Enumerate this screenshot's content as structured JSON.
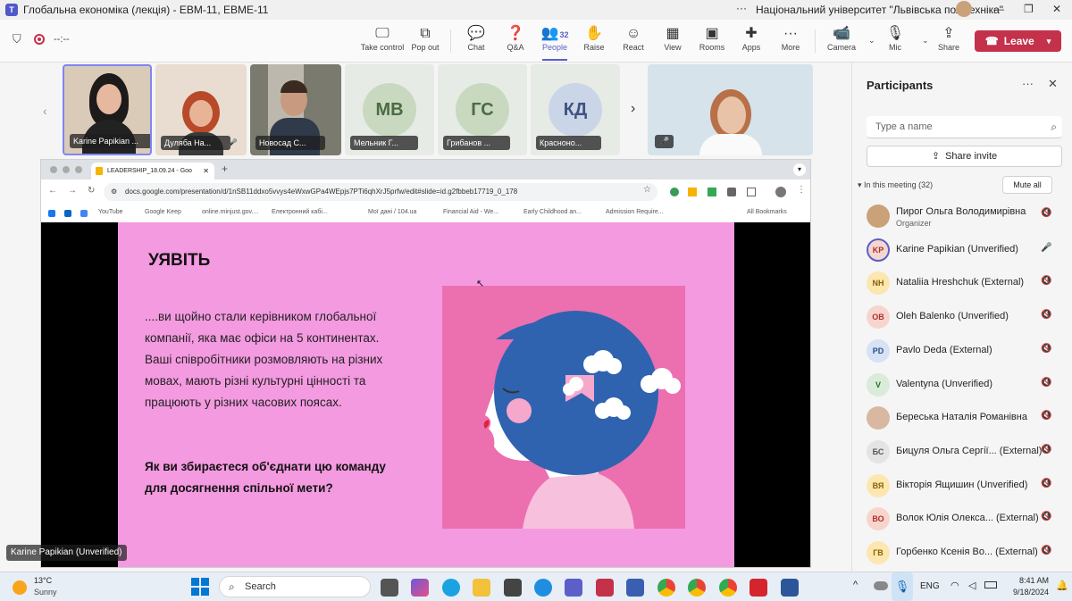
{
  "window": {
    "title": "Глобальна економіка (лекція) - ЕВМ-11, ЕВМЕ-11",
    "org": "Національний університет \"Львівська політехніка\""
  },
  "toolbar": {
    "timer": "--:--",
    "items": [
      {
        "label": "Take control",
        "icon": "take-control-icon"
      },
      {
        "label": "Pop out",
        "icon": "pop-out-icon"
      },
      {
        "label": "Chat",
        "icon": "chat-icon"
      },
      {
        "label": "Q&A",
        "icon": "qa-icon"
      },
      {
        "label": "People",
        "icon": "people-icon",
        "count": "32"
      },
      {
        "label": "Raise",
        "icon": "hand-icon"
      },
      {
        "label": "React",
        "icon": "emoji-icon"
      },
      {
        "label": "View",
        "icon": "view-icon"
      },
      {
        "label": "Rooms",
        "icon": "rooms-icon"
      },
      {
        "label": "Apps",
        "icon": "apps-icon"
      },
      {
        "label": "More",
        "icon": "more-icon"
      },
      {
        "label": "Camera",
        "icon": "camera-icon"
      },
      {
        "label": "Mic",
        "icon": "mic-off-icon"
      },
      {
        "label": "Share",
        "icon": "share-icon"
      }
    ],
    "leave": "Leave"
  },
  "gallery": [
    {
      "name": "Karine Papikian ...",
      "type": "video"
    },
    {
      "name": "Дуляба На...",
      "type": "video"
    },
    {
      "name": "Новосад С...",
      "type": "video"
    },
    {
      "name": "Мельник Г...",
      "initials": "МВ",
      "type": "avatar"
    },
    {
      "name": "Грибанов ...",
      "initials": "ГС",
      "type": "avatar"
    },
    {
      "name": "Красноно...",
      "initials": "КД",
      "type": "avatar"
    }
  ],
  "browser": {
    "tab_title": "LEADERSHIP_18.09.24 - Goo",
    "url": "docs.google.com/presentation/d/1nSB11ddxo5vvys4eWxwGPa4WEpjs7PTi6qhXrJ5prfw/edit#slide=id.g2fbbeb17719_0_178",
    "bookmarks": [
      "YouTube",
      "Google Keep",
      "online.minjust.gov....",
      "Електронний кабі...",
      "Мої дані / 104.ua",
      "Financial Aid - We...",
      "Early Childhood an...",
      "Admission Require...",
      "All Bookmarks"
    ]
  },
  "slide": {
    "title": "УЯВІТЬ",
    "body": "....ви щойно стали керівником глобальної компанії, яка має офіси на 5 континентах. Ваші співробітники розмовляють на різних мовах, мають різні культурні цінності та працюють у різних часових поясах.",
    "question": "Як ви збираєтеся об'єднати цю команду для досягнення спільної мети?"
  },
  "speaker_label": "Karine Papikian (Unverified)",
  "participants": {
    "title": "Participants",
    "search_placeholder": "Type a name",
    "share_invite": "Share invite",
    "section": "In this meeting (32)",
    "mute_all": "Mute all",
    "list": [
      {
        "name": "Пирог Ольга Володимирівна",
        "role": "Organizer",
        "initials": "",
        "bg": "#c9a27a",
        "fg": "#fff",
        "mic": "off"
      },
      {
        "name": "Karine Papikian (Unverified)",
        "role": "",
        "initials": "KP",
        "bg": "#f4d8cf",
        "fg": "#a33",
        "mic": "on"
      },
      {
        "name": "Nataliia Hreshchuk (External)",
        "role": "",
        "initials": "NH",
        "bg": "#fde7b0",
        "fg": "#8a6100",
        "mic": "off"
      },
      {
        "name": "Oleh Balenko (Unverified)",
        "role": "",
        "initials": "OB",
        "bg": "#f8d5cc",
        "fg": "#a33",
        "mic": "off"
      },
      {
        "name": "Pavlo Deda (External)",
        "role": "",
        "initials": "PD",
        "bg": "#d6e2f5",
        "fg": "#2b4f8a",
        "mic": "off"
      },
      {
        "name": "Valentyna (Unverified)",
        "role": "",
        "initials": "V",
        "bg": "#d9ecd9",
        "fg": "#2f6b2f",
        "mic": "off"
      },
      {
        "name": "Береська Наталія Романівна",
        "role": "",
        "initials": "",
        "bg": "#d8b8a0",
        "fg": "#fff",
        "mic": "off"
      },
      {
        "name": "Бицуля Ольга Сергії... (External)",
        "role": "",
        "initials": "БС",
        "bg": "#e4e4e4",
        "fg": "#555",
        "mic": "off"
      },
      {
        "name": "Вікторія Ящишин (Unverified)",
        "role": "",
        "initials": "ВЯ",
        "bg": "#fde7b0",
        "fg": "#8a6100",
        "mic": "off"
      },
      {
        "name": "Волок Юлія Олекса... (External)",
        "role": "",
        "initials": "ВО",
        "bg": "#f8d5cc",
        "fg": "#a33",
        "mic": "off"
      },
      {
        "name": "Горбенко Ксенія Во... (External)",
        "role": "",
        "initials": "ГВ",
        "bg": "#fde7b0",
        "fg": "#8a6100",
        "mic": "off"
      }
    ]
  },
  "taskbar": {
    "weather_temp": "13°C",
    "weather_desc": "Sunny",
    "search": "Search",
    "lang": "ENG",
    "time": "8:41 AM",
    "date": "9/18/2024"
  },
  "colors": {
    "accent": "#5b5fc7",
    "leave": "#c4314b",
    "slide_bg": "#f49ae0",
    "art_bg": "#ec6fb0",
    "hair": "#2f63b0"
  }
}
